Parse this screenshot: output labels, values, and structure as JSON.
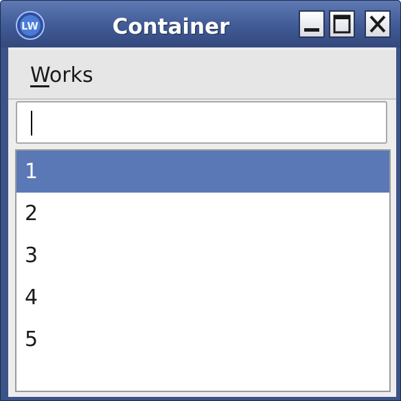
{
  "window": {
    "title": "Container",
    "icon": "lw-app-icon",
    "controls": [
      "minimize-icon",
      "maximize-icon",
      "close-icon"
    ]
  },
  "menubar": {
    "items": [
      {
        "label": "Works",
        "mnemonic": "W",
        "rest": "orks"
      }
    ]
  },
  "text_input": {
    "value": ""
  },
  "list": {
    "items": [
      "1",
      "2",
      "3",
      "4",
      "5"
    ],
    "selected_index": 0
  },
  "colors": {
    "titlebar": "#3f5a95",
    "selection": "#5b78b6",
    "client_background": "#ededed"
  }
}
